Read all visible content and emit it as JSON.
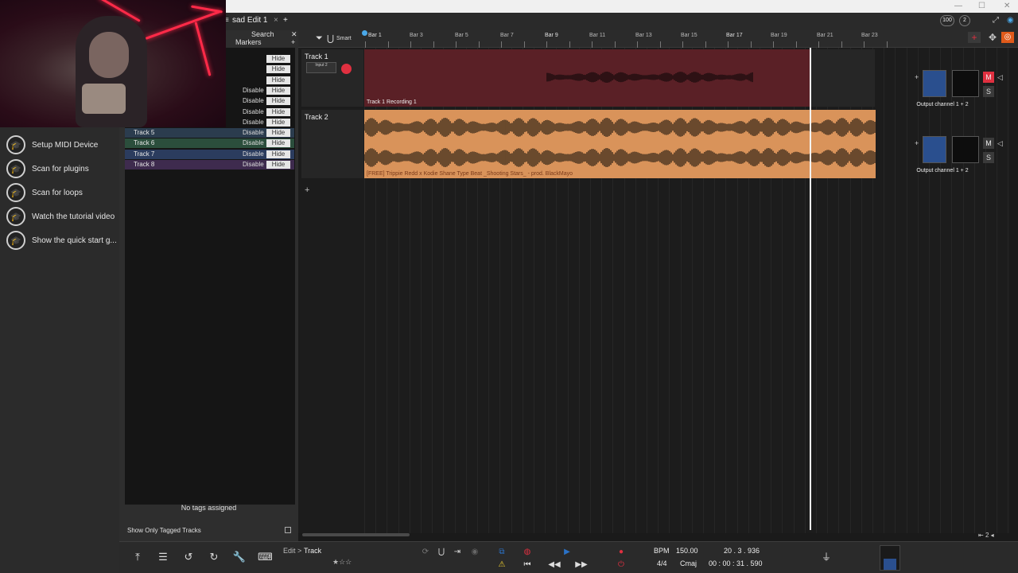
{
  "window": {
    "title_controls": [
      "—",
      "☐",
      "✕"
    ]
  },
  "tab": {
    "edit_name": "sad Edit 1",
    "close": "×",
    "add": "+"
  },
  "help_items": [
    {
      "label": "Setup MIDI Device"
    },
    {
      "label": "Scan for plugins"
    },
    {
      "label": "Scan for loops"
    },
    {
      "label": "Watch the tutorial video"
    },
    {
      "label": "Show the quick start g..."
    }
  ],
  "tag_panel": {
    "search_label": "Search",
    "markers_label": "Markers",
    "disable_label": "Disable",
    "hide_label": "Hide",
    "tracks": [
      {
        "name": "",
        "disable": false,
        "color": "#151515"
      },
      {
        "name": "",
        "disable": false,
        "color": "#151515"
      },
      {
        "name": "",
        "disable": false,
        "color": "#151515"
      },
      {
        "name": "",
        "disable": true,
        "color": "#151515"
      },
      {
        "name": "",
        "disable": true,
        "color": "#151515"
      },
      {
        "name": "",
        "disable": true,
        "color": "#151515"
      },
      {
        "name": "",
        "disable": true,
        "color": "#151515"
      },
      {
        "name": "Track 5",
        "disable": true,
        "color": "#2b3c4e"
      },
      {
        "name": "Track 6",
        "disable": true,
        "color": "#2b4e3c"
      },
      {
        "name": "Track 7",
        "disable": true,
        "color": "#2b3c5e"
      },
      {
        "name": "Track 8",
        "disable": true,
        "color": "#3e2b4e"
      }
    ],
    "no_tags": "No tags assigned",
    "show_tagged": "Show Only Tagged Tracks"
  },
  "toolbar": {
    "smart_label": "Smart"
  },
  "ruler": {
    "major_bars": [
      "Bar 1",
      "Bar 9",
      "Bar 17"
    ],
    "minor_bars": [
      "Bar 3",
      "Bar 5",
      "Bar 7",
      "Bar 11",
      "Bar 13",
      "Bar 15",
      "Bar 19",
      "Bar 21",
      "Bar 23"
    ]
  },
  "tracks": [
    {
      "name": "Track 1",
      "input_label": "Input 2",
      "clip_label": "Track 1 Recording 1",
      "output": "Output channel 1 + 2",
      "mute_label": "M",
      "solo_label": "S",
      "clip_color": "#5a2026",
      "wave_color": "#1a0b0d",
      "mute_active": true
    },
    {
      "name": "Track 2",
      "clip_label": "[FREE] Trippie Redd x Kodie Shane Type Beat _Shooting Stars_ - prod. BlackMayo",
      "output": "Output channel 1 + 2",
      "mute_label": "M",
      "solo_label": "S",
      "clip_color": "#d9935a",
      "wave_color": "#3a2a1a",
      "mute_active": false
    }
  ],
  "transport": {
    "edit_label": "Edit",
    "track_label": "Track",
    "crumb_sep": ">",
    "bpm_label": "BPM",
    "bpm": "150.00",
    "position_bars": "20 . 3 . 936",
    "time_sig": "4/4",
    "key": "Cmaj",
    "time": "00 : 00 : 31 . 590",
    "zoom": "2"
  },
  "colors": {
    "accent": "#e03040",
    "blue": "#2a72c8"
  }
}
